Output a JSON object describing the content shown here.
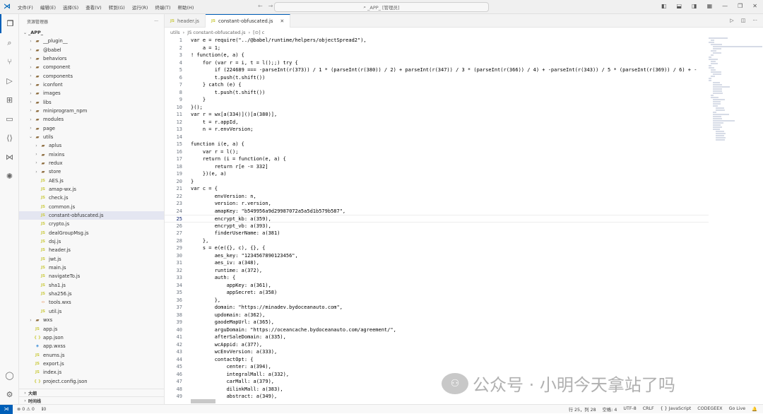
{
  "menu": [
    "文件(F)",
    "编辑(E)",
    "选择(S)",
    "查看(V)",
    "转到(G)",
    "运行(R)",
    "终端(T)",
    "帮助(H)"
  ],
  "search_text": "_APP_ [管理员]",
  "sidebar": {
    "title": "资源管理器",
    "more": "···",
    "root": "_APP_",
    "items": [
      {
        "label": "__plugin__",
        "type": "folder",
        "indent": 1,
        "chev": "›"
      },
      {
        "label": "@babel",
        "type": "folder",
        "indent": 1,
        "chev": "›"
      },
      {
        "label": "behaviors",
        "type": "folder",
        "indent": 1,
        "chev": "›"
      },
      {
        "label": "component",
        "type": "folder",
        "indent": 1,
        "chev": "›"
      },
      {
        "label": "components",
        "type": "folder",
        "indent": 1,
        "chev": "›"
      },
      {
        "label": "iconfont",
        "type": "folder",
        "indent": 1,
        "chev": "›"
      },
      {
        "label": "images",
        "type": "folder",
        "indent": 1,
        "chev": "›"
      },
      {
        "label": "libs",
        "type": "folder",
        "indent": 1,
        "chev": "›"
      },
      {
        "label": "miniprogram_npm",
        "type": "folder",
        "indent": 1,
        "chev": "›"
      },
      {
        "label": "modules",
        "type": "folder",
        "indent": 1,
        "chev": "›"
      },
      {
        "label": "page",
        "type": "folder",
        "indent": 1,
        "chev": "›"
      },
      {
        "label": "utils",
        "type": "folder",
        "indent": 1,
        "chev": "⌄"
      },
      {
        "label": "aplus",
        "type": "folder",
        "indent": 2,
        "chev": "›"
      },
      {
        "label": "mixins",
        "type": "folder",
        "indent": 2,
        "chev": "›"
      },
      {
        "label": "redux",
        "type": "folder",
        "indent": 2,
        "chev": "›"
      },
      {
        "label": "store",
        "type": "folder",
        "indent": 2,
        "chev": "›"
      },
      {
        "label": "AES.js",
        "type": "js",
        "indent": 2,
        "chev": ""
      },
      {
        "label": "amap-wx.js",
        "type": "js",
        "indent": 2,
        "chev": ""
      },
      {
        "label": "check.js",
        "type": "js",
        "indent": 2,
        "chev": ""
      },
      {
        "label": "common.js",
        "type": "js",
        "indent": 2,
        "chev": ""
      },
      {
        "label": "constant-obfuscated.js",
        "type": "js",
        "indent": 2,
        "chev": "",
        "selected": true
      },
      {
        "label": "crypto.js",
        "type": "js",
        "indent": 2,
        "chev": ""
      },
      {
        "label": "dealGroupMsg.js",
        "type": "js",
        "indent": 2,
        "chev": ""
      },
      {
        "label": "dsj.js",
        "type": "js",
        "indent": 2,
        "chev": ""
      },
      {
        "label": "header.js",
        "type": "js",
        "indent": 2,
        "chev": ""
      },
      {
        "label": "jwt.js",
        "type": "js",
        "indent": 2,
        "chev": ""
      },
      {
        "label": "main.js",
        "type": "js",
        "indent": 2,
        "chev": ""
      },
      {
        "label": "navigateTo.js",
        "type": "js",
        "indent": 2,
        "chev": ""
      },
      {
        "label": "sha1.js",
        "type": "js",
        "indent": 2,
        "chev": ""
      },
      {
        "label": "sha256.js",
        "type": "js",
        "indent": 2,
        "chev": ""
      },
      {
        "label": "tools.wxs",
        "type": "wxs",
        "indent": 2,
        "chev": ""
      },
      {
        "label": "util.js",
        "type": "js",
        "indent": 2,
        "chev": ""
      },
      {
        "label": "wxs",
        "type": "folder",
        "indent": 1,
        "chev": "›"
      },
      {
        "label": "app.js",
        "type": "js",
        "indent": 1,
        "chev": ""
      },
      {
        "label": "app.json",
        "type": "json",
        "indent": 1,
        "chev": ""
      },
      {
        "label": "app.wxss",
        "type": "wxss",
        "indent": 1,
        "chev": ""
      },
      {
        "label": "enums.js",
        "type": "js",
        "indent": 1,
        "chev": ""
      },
      {
        "label": "export.js",
        "type": "js",
        "indent": 1,
        "chev": ""
      },
      {
        "label": "index.js",
        "type": "js",
        "indent": 1,
        "chev": ""
      },
      {
        "label": "project.config.json",
        "type": "json",
        "indent": 1,
        "chev": ""
      }
    ],
    "footer": [
      "大纲",
      "时间线"
    ]
  },
  "tabs": [
    {
      "label": "header.js",
      "active": false
    },
    {
      "label": "constant-obfuscated.js",
      "active": true
    }
  ],
  "breadcrumb": [
    "utils",
    "›",
    "JS constant-obfuscated.js",
    "›",
    "[⊙] c"
  ],
  "code_lines": [
    "var e = require(\"../@babel/runtime/helpers/objectSpread2\"),",
    "    a = 1;",
    "! function(e, a) {",
    "    for (var r = i, t = l();;) try {",
    "        if (224689 === -parseInt(r(373)) / 1 * (parseInt(r(380)) / 2) + parseInt(r(347)) / 3 * (parseInt(r(366)) / 4) + -parseInt(r(343)) / 5 * (parseInt(r(369)) / 6) + -",
    "        t.push(t.shift())",
    "    } catch (e) {",
    "        t.push(t.shift())",
    "    }",
    "}();",
    "var r = wx[a(334)]()[a(380)],",
    "    t = r.appId,",
    "    n = r.envVersion;",
    "",
    "function i(e, a) {",
    "    var r = l();",
    "    return (i = function(e, a) {",
    "        return r[e -= 332]",
    "    })(e, a)",
    "}",
    "var c = {",
    "        envVersion: n,",
    "        version: r.version,",
    "        amapKey: \"b549956a9d29987072a5a5d1b579b587\",",
    "        encrypt_kb: a(359),",
    "        encrypt_vb: a(393),",
    "        finderUserName: a(381)",
    "    },",
    "    s = e(e({}, c), {}, {",
    "        aes_key: \"1234567890123456\",",
    "        aes_iv: a(348),",
    "        runtime: a(372),",
    "        auth: {",
    "            appKey: a(361),",
    "            appSecret: a(358)",
    "        },",
    "        domain: \"https://minadev.bydoceanauto.com\",",
    "        updomain: a(362),",
    "        gaodeMapUrl: a(365),",
    "        arguDomain: \"https://oceancache.bydoceanauto.com/agreement/\",",
    "        afterSaleDomain: a(335),",
    "        wcAppid: a(377),",
    "        wcEnvVersion: a(333),",
    "        contactOpt: {",
    "            center: a(394),",
    "            integralMall: a(332),",
    "            carMall: a(379),",
    "            dilinkMall: a(383),",
    "            abstract: a(349),"
  ],
  "current_line": 25,
  "status": {
    "errors": "⊗ 0 ⚠ 0",
    "ports": "ℹ0",
    "position": "行 25，列 28",
    "spaces": "空格: 4",
    "encoding": "UTF-8",
    "eol": "CRLF",
    "language": "{ } JavaScript",
    "codegeex": "CODEGEEX",
    "golive": "Go Live"
  },
  "watermark": "公众号 · 小明今天拿站了吗"
}
